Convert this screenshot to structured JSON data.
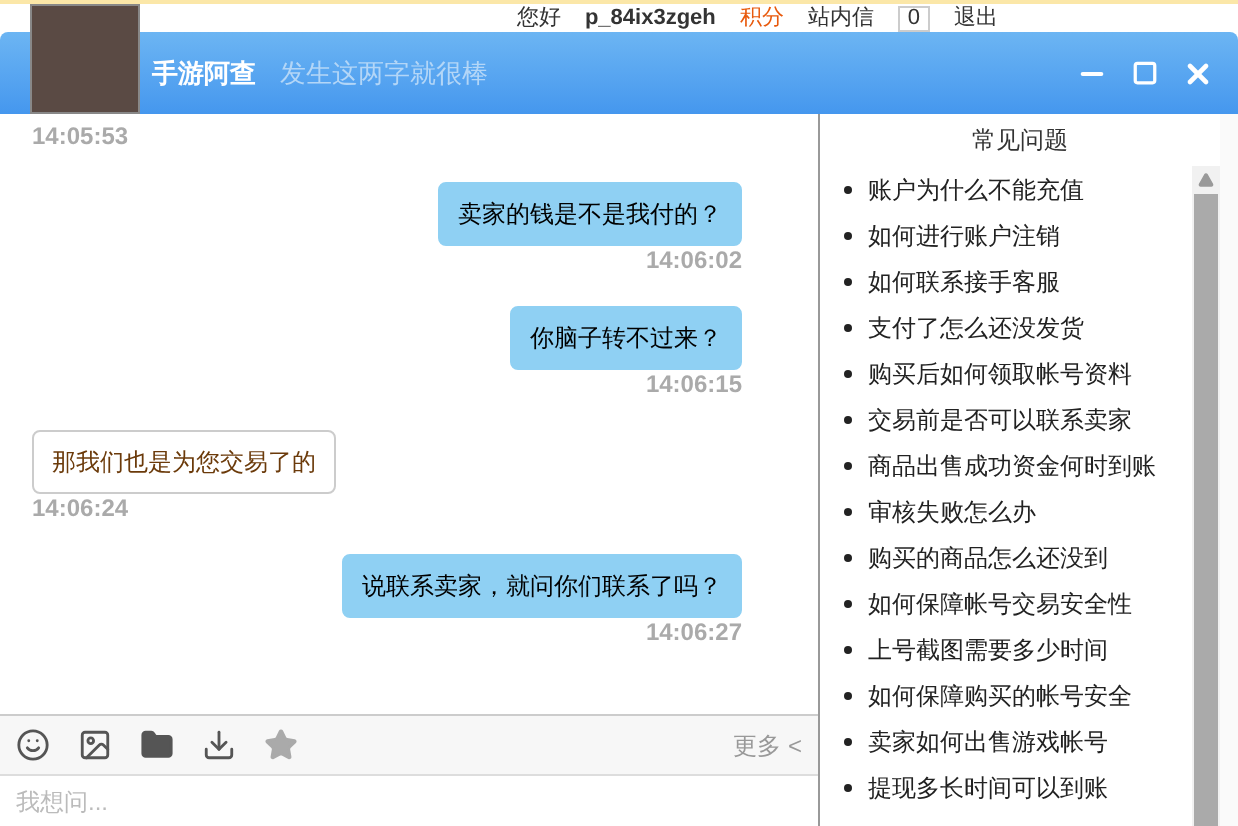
{
  "page_bar": {
    "greeting": "您好",
    "username": "p_84ix3zgeh",
    "points": "积分",
    "inbox": "站内信",
    "inbox_count": "0",
    "logout": "退出"
  },
  "window": {
    "title": "手游阿查",
    "subtitle": "发生这两字就很棒"
  },
  "messages": [
    {
      "kind": "time",
      "outgoing": false,
      "text": "14:05:53"
    },
    {
      "kind": "bubble",
      "outgoing": true,
      "text": "卖家的钱是不是我付的？"
    },
    {
      "kind": "time",
      "outgoing": true,
      "text": "14:06:02"
    },
    {
      "kind": "bubble",
      "outgoing": true,
      "text": "你脑子转不过来？"
    },
    {
      "kind": "time",
      "outgoing": true,
      "text": "14:06:15"
    },
    {
      "kind": "bubble",
      "outgoing": false,
      "text": "那我们也是为您交易了的"
    },
    {
      "kind": "time",
      "outgoing": false,
      "text": "14:06:24"
    },
    {
      "kind": "bubble",
      "outgoing": true,
      "text": "说联系卖家，就问你们联系了吗？"
    },
    {
      "kind": "time",
      "outgoing": true,
      "text": "14:06:27"
    }
  ],
  "toolbar": {
    "more": "更多 <"
  },
  "input": {
    "placeholder": "我想问..."
  },
  "faq": {
    "title": "常见问题",
    "items": [
      "账户为什么不能充值",
      "如何进行账户注销",
      "如何联系接手客服",
      "支付了怎么还没发货",
      "购买后如何领取帐号资料",
      "交易前是否可以联系卖家",
      "商品出售成功资金何时到账",
      "审核失败怎么办",
      "购买的商品怎么还没到",
      "如何保障帐号交易安全性",
      "上号截图需要多少时间",
      "如何保障购买的帐号安全",
      "卖家如何出售游戏帐号",
      "提现多长时间可以到账"
    ]
  }
}
